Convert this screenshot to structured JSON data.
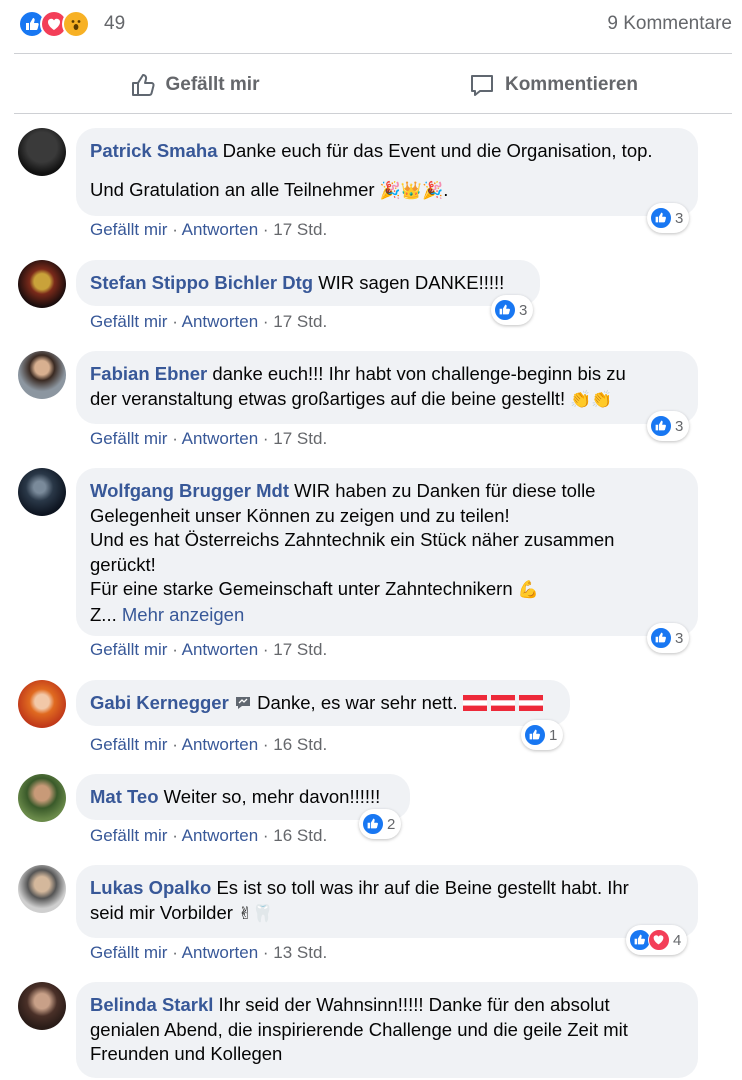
{
  "summary": {
    "reaction_count": "49",
    "comment_count": "9 Kommentare",
    "reaction_icons": [
      "like-icon",
      "love-icon",
      "wow-icon"
    ]
  },
  "actions": {
    "like_label": "Gefällt mir",
    "comment_label": "Kommentieren"
  },
  "meta": {
    "like": "Gefällt mir",
    "reply": "Antworten",
    "sep": " · "
  },
  "comments": [
    {
      "author": "Patrick Smaha",
      "lines": [
        "Danke euch für das Event und die Organisation, top.",
        "Und Gratulation an alle Teilnehmer",
        "🎉👑🎉",
        "."
      ],
      "time": "17 Std.",
      "reaction_count": "3"
    },
    {
      "author": "Stefan Stippo Bichler Dtg",
      "lines": [
        "WIR sagen DANKE!!!!!"
      ],
      "time": "17 Std.",
      "reaction_count": "3"
    },
    {
      "author": "Fabian Ebner",
      "lines": [
        "danke euch!!! Ihr habt von challenge-beginn bis zu",
        "der veranstaltung etwas großartiges auf die beine gestellt!",
        "👏👏"
      ],
      "time": "17 Std.",
      "reaction_count": "3"
    },
    {
      "author": "Wolfgang Brugger Mdt",
      "lines": [
        "WIR haben zu Danken für diese tolle",
        "Gelegenheit unser Können zu zeigen und zu teilen!",
        "Und es hat Österreichs Zahntechnik ein Stück näher zusammen",
        "gerückt!",
        "Für eine starke Gemeinschaft unter Zahntechnikern",
        "💪",
        "Z...",
        "Mehr anzeigen"
      ],
      "time": "17 Std.",
      "reaction_count": "3"
    },
    {
      "author": "Gabi Kernegger",
      "lines": [
        "Danke, es war sehr nett."
      ],
      "time": "16 Std.",
      "reaction_count": "1"
    },
    {
      "author": "Mat Teo",
      "lines": [
        "Weiter so, mehr davon!!!!!!"
      ],
      "time": "16 Std.",
      "reaction_count": "2"
    },
    {
      "author": "Lukas Opalko",
      "lines": [
        "Es ist so toll was ihr auf die Beine gestellt habt. Ihr",
        "seid mir Vorbilder",
        "✌🦷"
      ],
      "time": "13 Std.",
      "reaction_count": "4"
    },
    {
      "author": "Belinda Starkl",
      "lines": [
        "Ihr seid der Wahnsinn!!!!! Danke für den absolut",
        "genialen Abend, die inspirierende Challenge und die geile Zeit mit",
        "Freunden und Kollegen"
      ]
    }
  ],
  "colors": {
    "link": "#385898",
    "bubble": "#f0f2f5",
    "like": "#1877f2",
    "love": "#f33e58",
    "wow": "#f7b125"
  }
}
